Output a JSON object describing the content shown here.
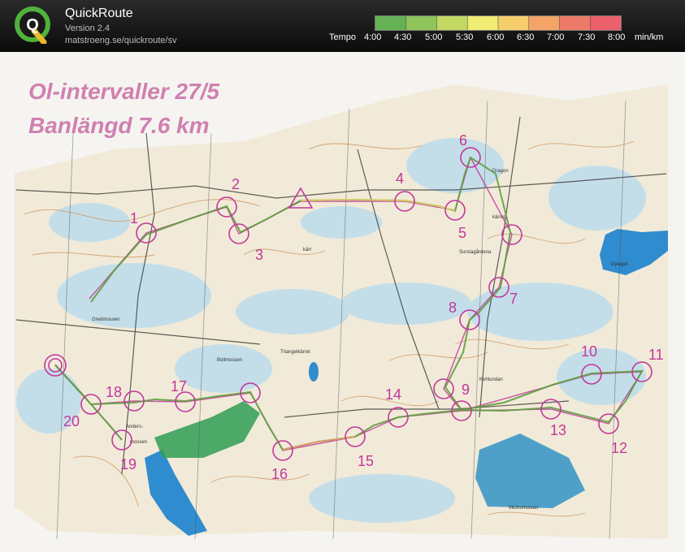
{
  "app": {
    "title": "QuickRoute",
    "version": "Version 2.4",
    "url": "matstroeng.se/quickroute/sv",
    "logo_letter": "Q"
  },
  "tempo_scale": {
    "label": "Tempo",
    "ticks": [
      "4:00",
      "4:30",
      "5:00",
      "5:30",
      "6:00",
      "6:30",
      "7:00",
      "7:30",
      "8:00"
    ],
    "unit": "min/km",
    "colors": [
      "#64b255",
      "#8fc45a",
      "#c3d863",
      "#f0ec74",
      "#f6cf6c",
      "#f3a466",
      "#ee7b69",
      "#ec5f6b"
    ]
  },
  "map": {
    "heading_line1": "Ol-intervaller 27/5",
    "heading_line2": "Banlängd 7.6 km",
    "place_names": [
      "Gredmossen",
      "Triangelkärret",
      "Bollmossen",
      "Anders-",
      "mossen",
      "Kohlundan",
      "Micksmossen",
      "Surstagårdena",
      "Dragon",
      "kärret",
      "Dylaget",
      "kärr"
    ],
    "controls": [
      "1",
      "2",
      "3",
      "4",
      "5",
      "6",
      "7",
      "8",
      "9",
      "10",
      "11",
      "12",
      "13",
      "14",
      "15",
      "16",
      "17",
      "18",
      "19",
      "20"
    ],
    "course_color": "#c2379b",
    "route_color": "#4f9b3e"
  }
}
